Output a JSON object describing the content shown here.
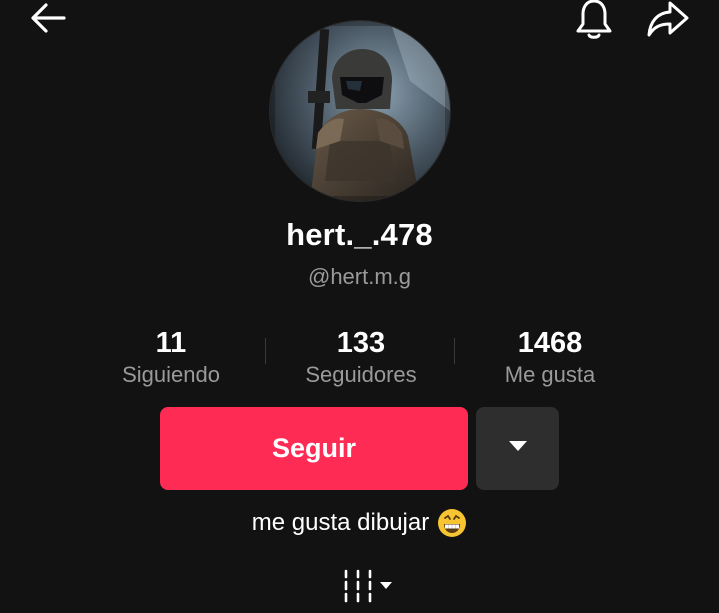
{
  "header": {
    "back_icon": "arrow-left-icon",
    "bell_icon": "bell-icon",
    "share_icon": "share-arrow-icon"
  },
  "profile": {
    "avatar_icon": "avatar-photo",
    "display_name": "hert._.478",
    "handle": "@hert.m.g"
  },
  "stats": [
    {
      "value": "11",
      "label": "Siguiendo"
    },
    {
      "value": "133",
      "label": "Seguidores"
    },
    {
      "value": "1468",
      "label": "Me gusta"
    }
  ],
  "actions": {
    "follow_label": "Seguir",
    "more_icon": "caret-down-icon"
  },
  "bio": {
    "text": "me gusta dibujar",
    "emoji_icon": "grinning-face-emoji"
  },
  "grid_toggle_icon": "grid-columns-icon",
  "colors": {
    "background": "#121212",
    "accent": "#fe2c55",
    "secondary_text": "#9a9a9a",
    "secondary_button": "#2e2e2e"
  }
}
